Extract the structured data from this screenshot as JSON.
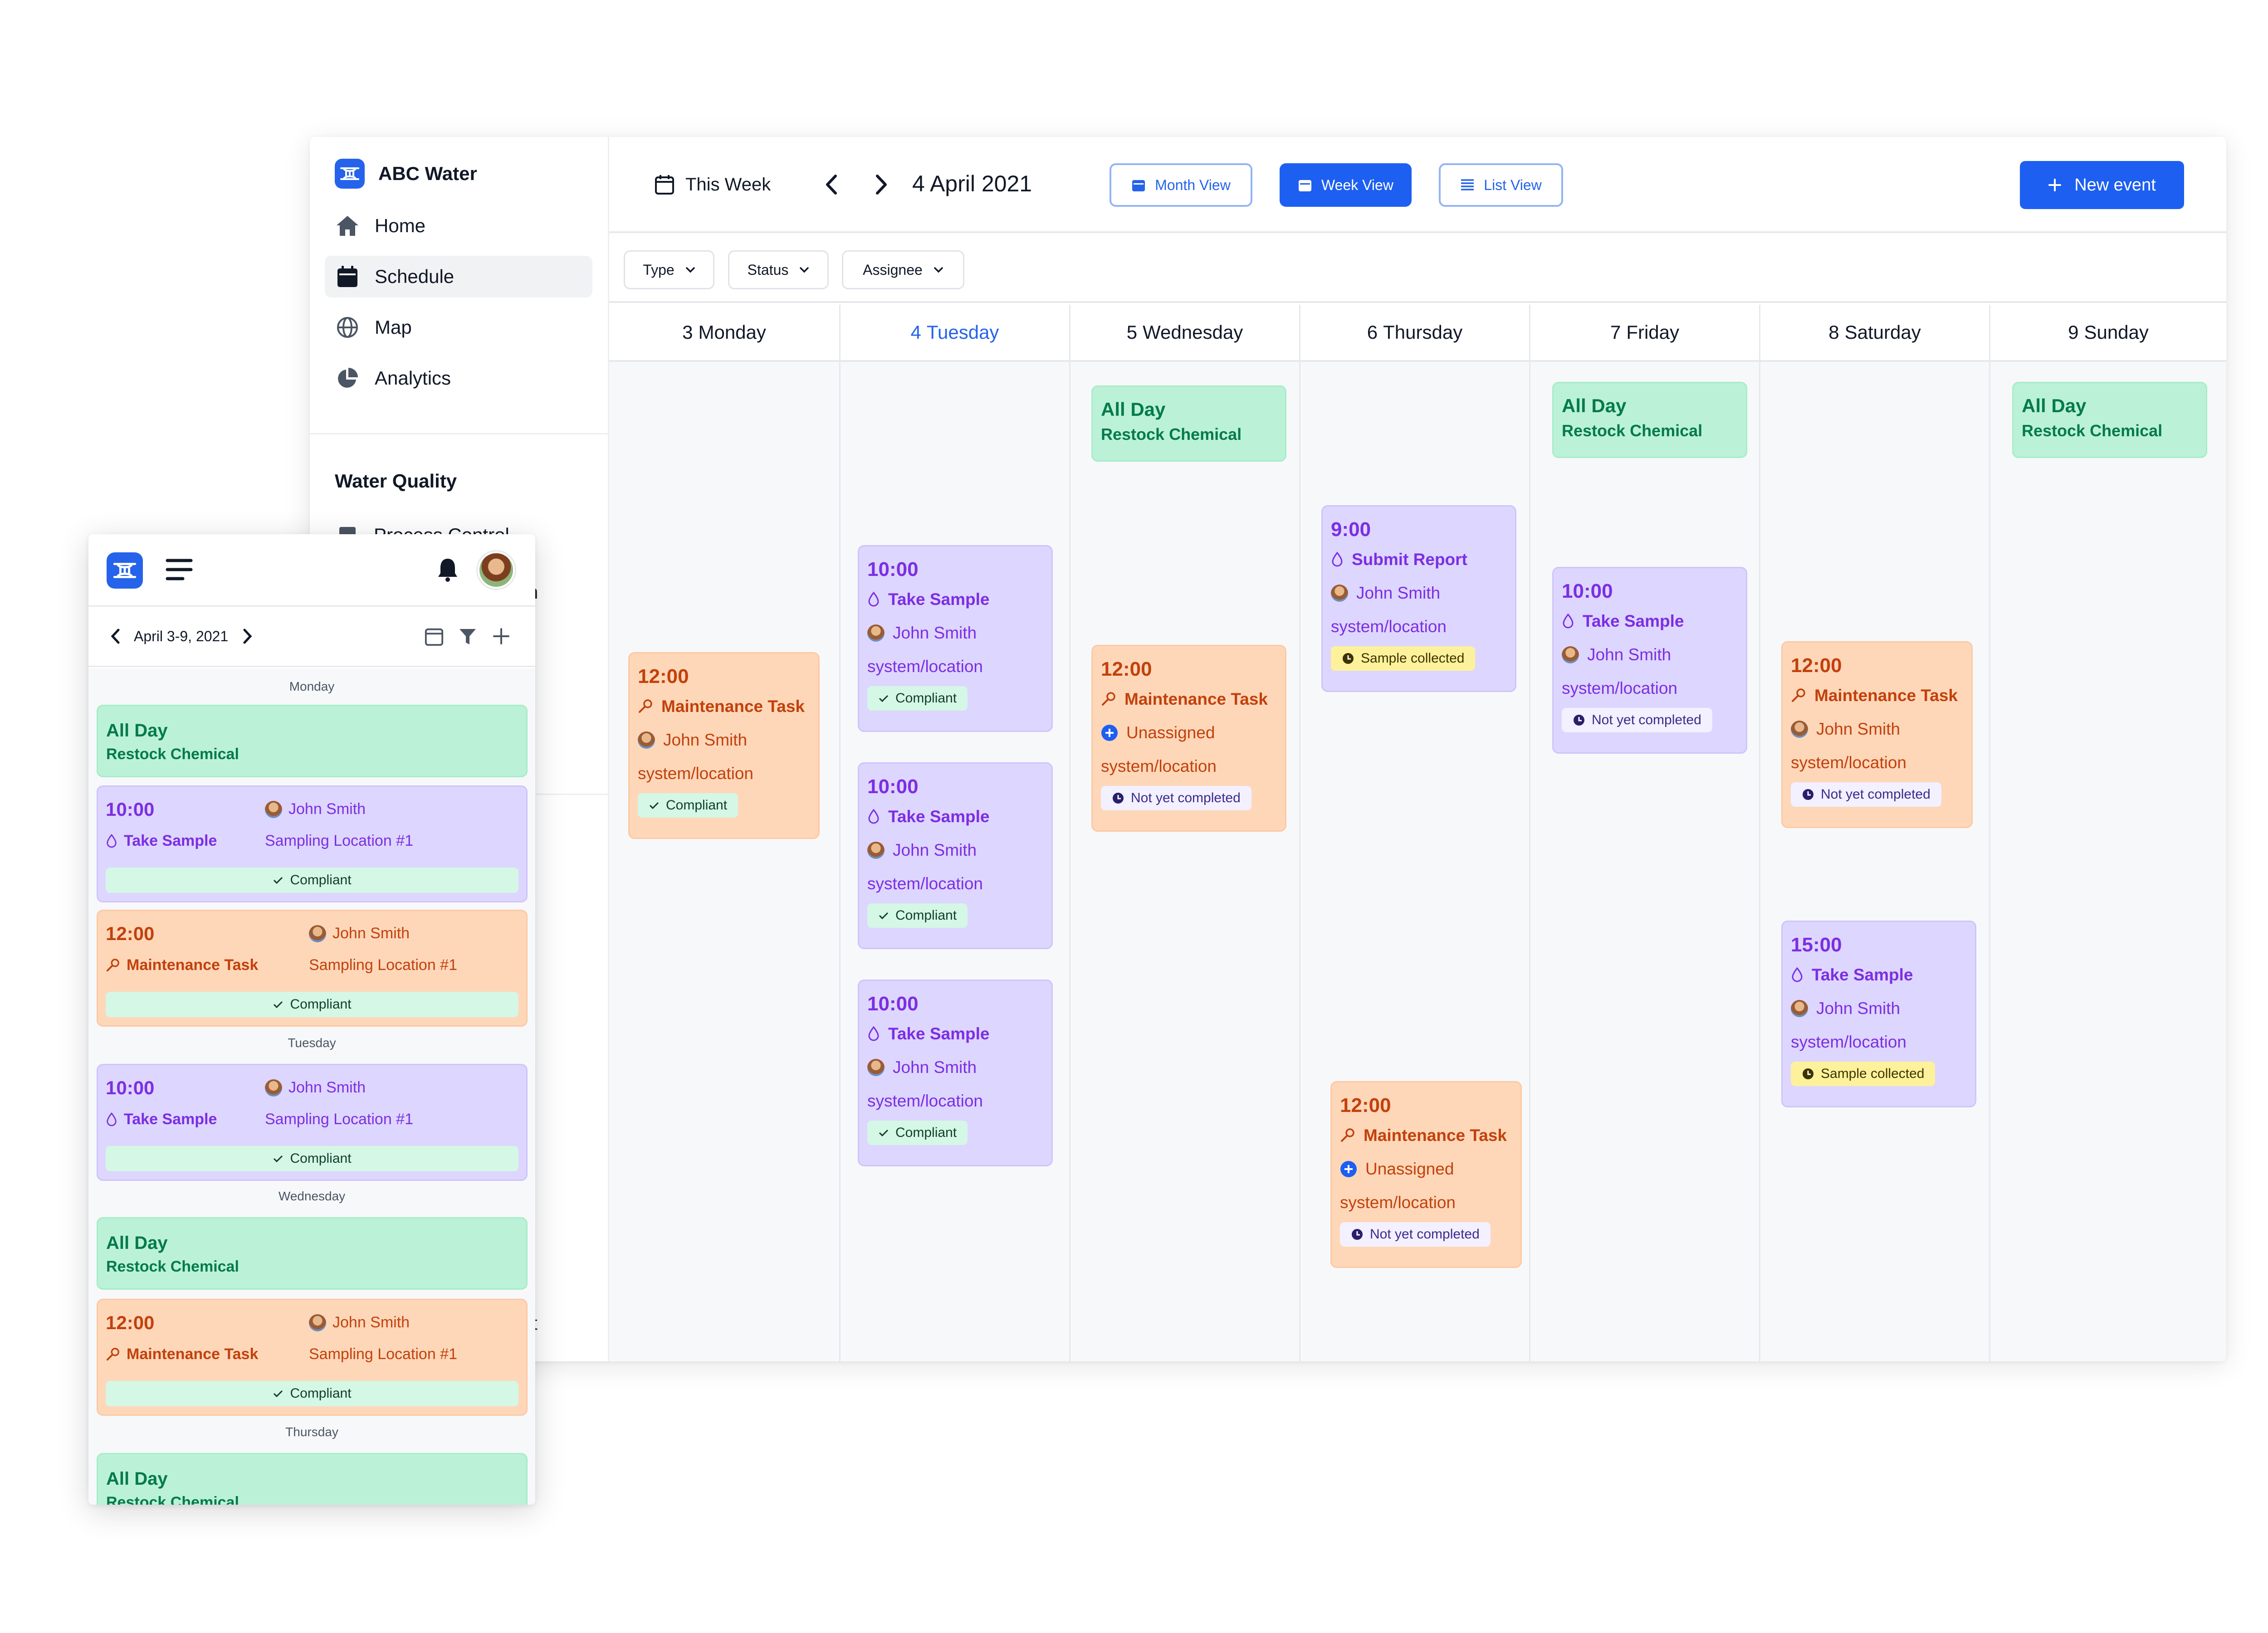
{
  "app": {
    "name": "ABC Water"
  },
  "sidebar": {
    "items": [
      {
        "label": "Home"
      },
      {
        "label": "Schedule"
      },
      {
        "label": "Map"
      },
      {
        "label": "Analytics"
      }
    ],
    "section_title": "Water Quality",
    "section_item_cut": "Process Control",
    "fragment_n": "n",
    "fragment_t": "t"
  },
  "toolbar": {
    "range_label": "This Week",
    "date_title": "4 April 2021",
    "month_view": "Month View",
    "week_view": "Week View",
    "list_view": "List View",
    "new_event": "New event"
  },
  "filters": [
    "Type",
    "Status",
    "Assignee"
  ],
  "days": [
    {
      "num": "3",
      "name": "Monday"
    },
    {
      "num": "4",
      "name": "Tuesday"
    },
    {
      "num": "5",
      "name": "Wednesday"
    },
    {
      "num": "6",
      "name": "Thursday"
    },
    {
      "num": "7",
      "name": "Friday"
    },
    {
      "num": "8",
      "name": "Saturday"
    },
    {
      "num": "9",
      "name": "Sunday"
    }
  ],
  "allday": {
    "time": "All Day",
    "title": "Restock Chemical"
  },
  "events": {
    "mon_1200": {
      "time": "12:00",
      "task": "Maintenance Task",
      "person": "John Smith",
      "location": "system/location",
      "status": "Compliant"
    },
    "tue_a": {
      "time": "10:00",
      "task": "Take Sample",
      "person": "John Smith",
      "location": "system/location",
      "status": "Compliant"
    },
    "tue_b": {
      "time": "10:00",
      "task": "Take Sample",
      "person": "John Smith",
      "location": "system/location",
      "status": "Compliant"
    },
    "tue_c": {
      "time": "10:00",
      "task": "Take Sample",
      "person": "John Smith",
      "location": "system/location",
      "status": "Compliant"
    },
    "wed_1200": {
      "time": "12:00",
      "task": "Maintenance Task",
      "person": "Unassigned",
      "location": "system/location",
      "status": "Not yet completed"
    },
    "thu_0900": {
      "time": "9:00",
      "task": "Submit Report",
      "person": "John Smith",
      "location": "system/location",
      "status": "Sample collected"
    },
    "thu_1200": {
      "time": "12:00",
      "task": "Maintenance Task",
      "person": "Unassigned",
      "location": "system/location",
      "status": "Not yet completed"
    },
    "fri_1000": {
      "time": "10:00",
      "task": "Take Sample",
      "person": "John Smith",
      "location": "system/location",
      "status": "Not yet completed"
    },
    "sat_1200": {
      "time": "12:00",
      "task": "Maintenance Task",
      "person": "John Smith",
      "location": "system/location",
      "status": "Not yet completed"
    },
    "sat_1500": {
      "time": "15:00",
      "task": "Take Sample",
      "person": "John Smith",
      "location": "system/location",
      "status": "Sample collected"
    }
  },
  "mobile": {
    "range": "April 3-9, 2021",
    "day_labels": [
      "Monday",
      "Tuesday",
      "Wednesday",
      "Thursday"
    ],
    "cards": {
      "mon_allday": {
        "time": "All Day",
        "title": "Restock Chemical"
      },
      "mon_sample": {
        "time": "10:00",
        "task": "Take Sample",
        "person": "John Smith",
        "location": "Sampling Location #1",
        "status": "Compliant"
      },
      "mon_maint": {
        "time": "12:00",
        "task": "Maintenance Task",
        "person": "John Smith",
        "location": "Sampling Location #1",
        "status": "Compliant"
      },
      "tue_sample": {
        "time": "10:00",
        "task": "Take Sample",
        "person": "John Smith",
        "location": "Sampling Location #1",
        "status": "Compliant"
      },
      "wed_allday": {
        "time": "All Day",
        "title": "Restock Chemical"
      },
      "wed_maint": {
        "time": "12:00",
        "task": "Maintenance Task",
        "person": "John Smith",
        "location": "Sampling Location #1",
        "status": "Compliant"
      },
      "thu_allday": {
        "time": "All Day",
        "title": "Restock Chemical"
      }
    }
  },
  "colors": {
    "accent": "#1d5ff0",
    "event_purple": "#ddd6fe",
    "event_orange": "#fed7b9",
    "event_green": "#bbf2d7"
  }
}
